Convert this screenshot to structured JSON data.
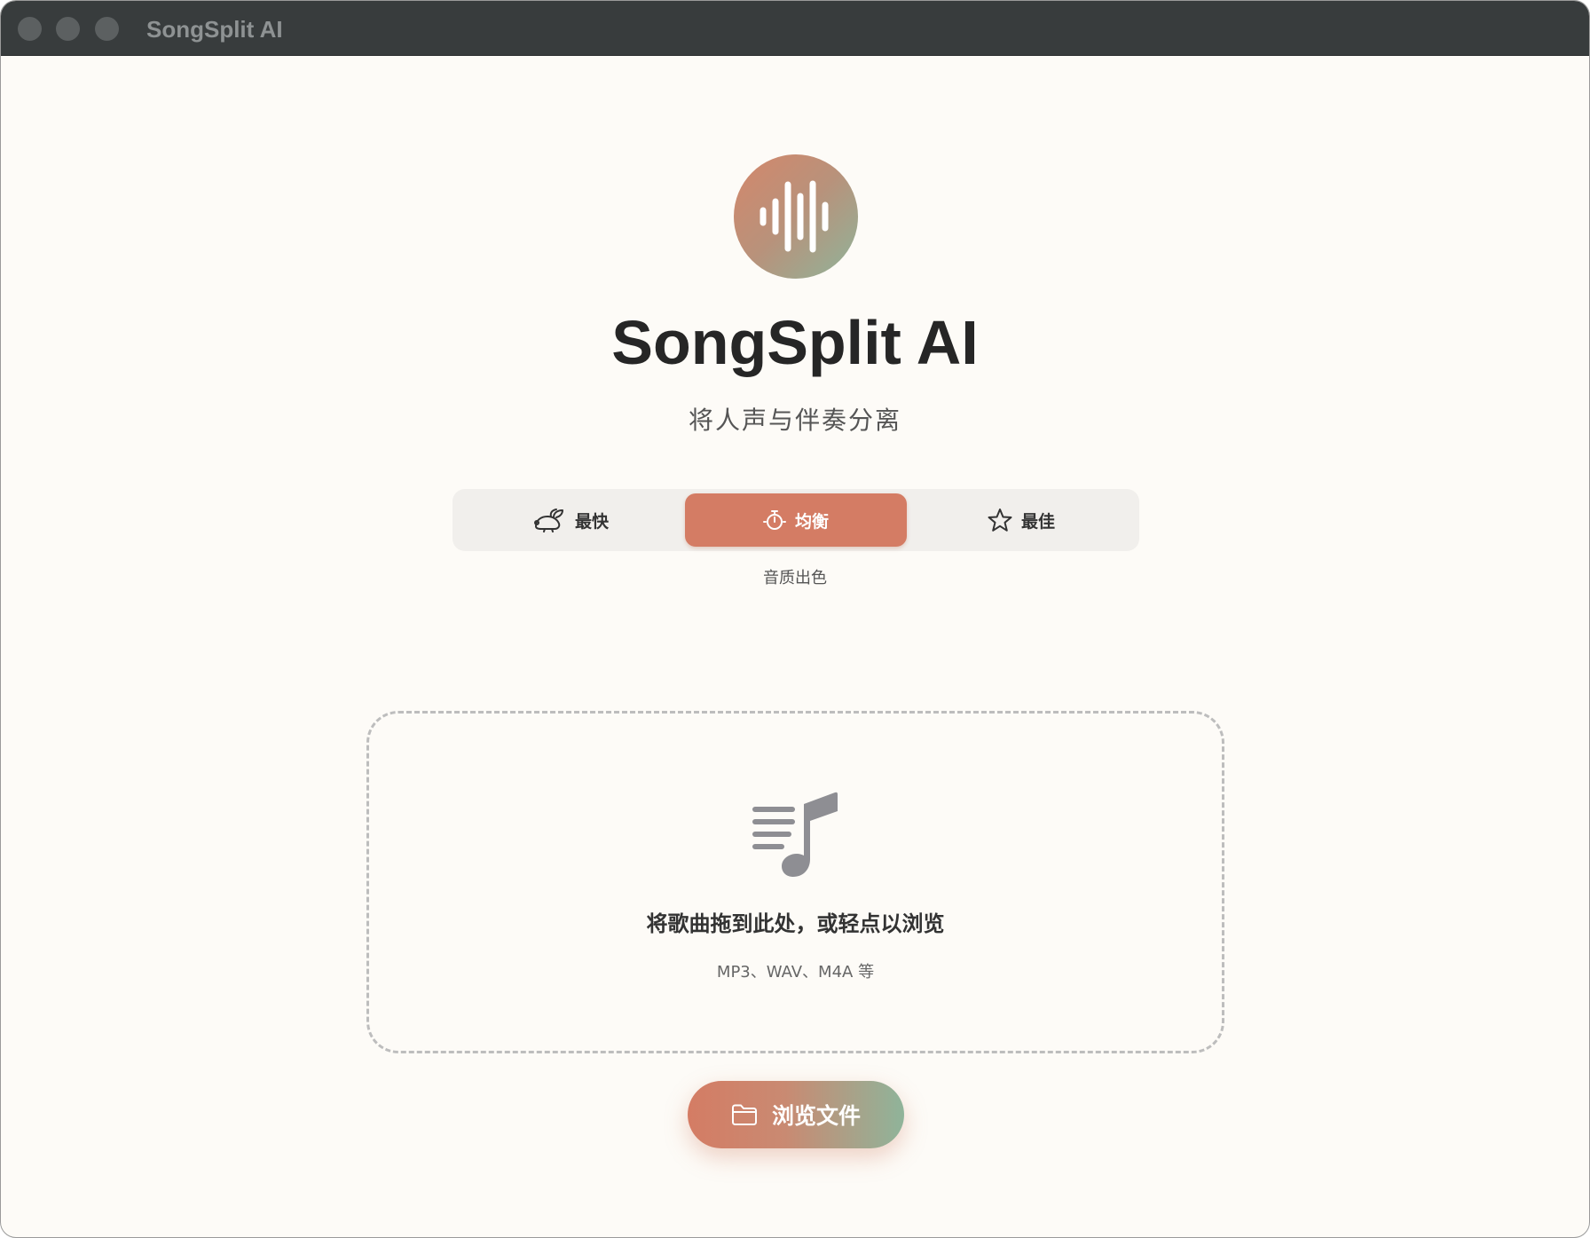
{
  "window": {
    "title": "SongSplit AI",
    "traffic_lights": [
      "close",
      "minimize",
      "zoom"
    ]
  },
  "header": {
    "logo_icon": "waveform-icon",
    "app_title": "SongSplit AI",
    "subtitle": "将人声与伴奏分离"
  },
  "quality_modes": {
    "options": [
      {
        "label": "最快",
        "icon": "rabbit-icon",
        "selected": false
      },
      {
        "label": "均衡",
        "icon": "timer-icon",
        "selected": true
      },
      {
        "label": "最佳",
        "icon": "star-icon",
        "selected": false
      }
    ],
    "description": "音质出色"
  },
  "dropzone": {
    "icon": "music-list-icon",
    "title": "将歌曲拖到此处，或轻点以浏览",
    "hint": "MP3、WAV、M4A 等"
  },
  "browse_button": {
    "label": "浏览文件",
    "icon": "folder-icon"
  },
  "colors": {
    "accent": "#d47c64",
    "accent_green": "#8fb49a",
    "background": "#fdfbf7",
    "titlebar": "#383c3d"
  }
}
